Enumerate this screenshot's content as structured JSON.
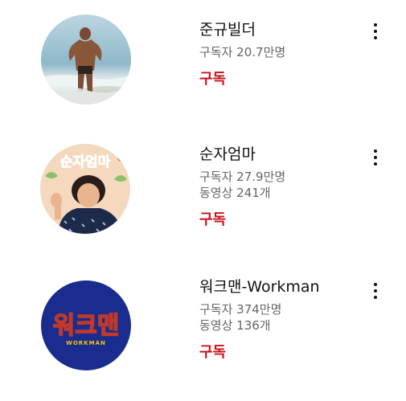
{
  "channels": [
    {
      "name": "준규빌더",
      "subscribers": "구독자 20.7만명",
      "videos": "",
      "subscribe_label": "구독",
      "avatar_icon": "beach-bodybuilder-photo"
    },
    {
      "name": "순자엄마",
      "subscribers": "구독자 27.9만명",
      "videos": "동영상 241개",
      "subscribe_label": "구독",
      "avatar_icon": "woman-waving-photo",
      "avatar_text": "순자엄마"
    },
    {
      "name": "워크맨-Workman",
      "subscribers": "구독자 374만명",
      "videos": "동영상 136개",
      "subscribe_label": "구독",
      "avatar_icon": "workman-logo",
      "avatar_text": "워크맨",
      "avatar_subtext": "WORKMAN"
    }
  ],
  "colors": {
    "subscribe": "#c8131b",
    "workman_bg": "#1a2d8f",
    "workman_text": "#f1c40f"
  }
}
